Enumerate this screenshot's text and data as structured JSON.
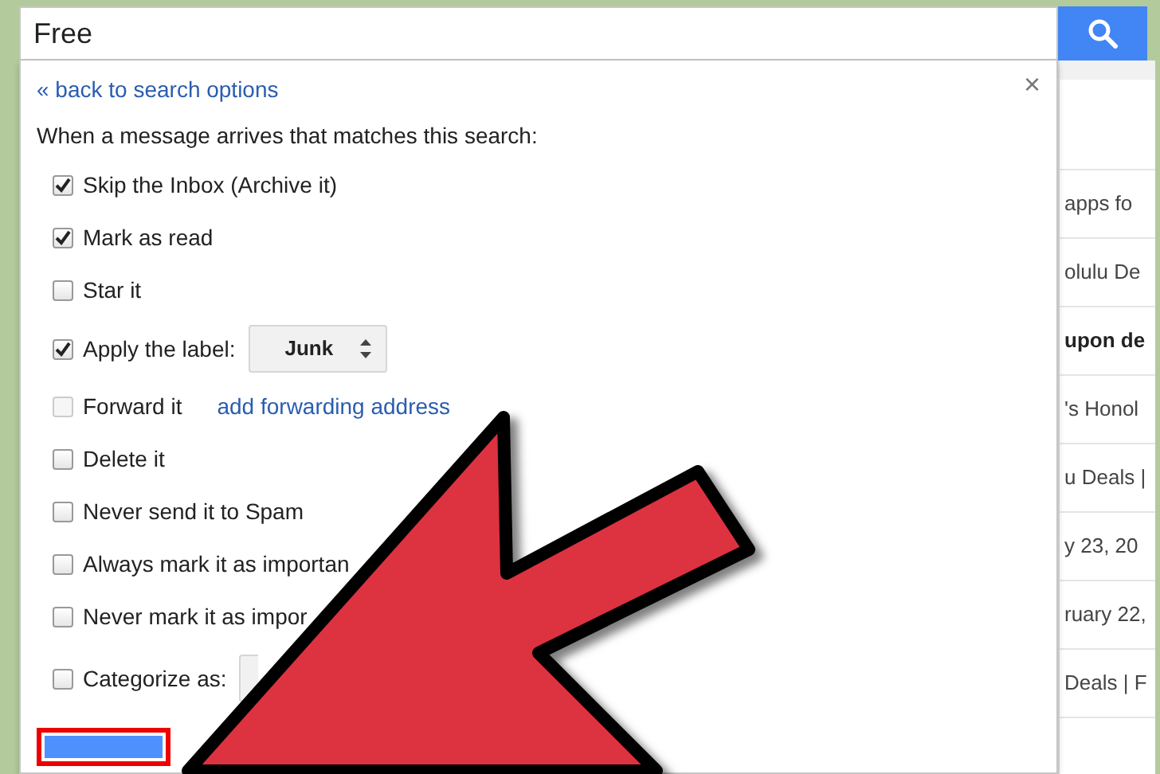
{
  "search": {
    "value": "Free"
  },
  "dialog": {
    "back_link": "« back to search options",
    "close": "×",
    "intro": "When a message arrives that matches this search:",
    "options": [
      {
        "kind": "checkbox",
        "label": "Skip the Inbox (Archive it)",
        "checked": true,
        "disabled": false
      },
      {
        "kind": "checkbox",
        "label": "Mark as read",
        "checked": true,
        "disabled": false
      },
      {
        "kind": "checkbox",
        "label": "Star it",
        "checked": false,
        "disabled": false
      },
      {
        "kind": "select",
        "label": "Apply the label:",
        "checked": true,
        "disabled": false,
        "value": "Junk"
      },
      {
        "kind": "link",
        "label": "Forward it",
        "checked": false,
        "disabled": true,
        "link": "add forwarding address"
      },
      {
        "kind": "checkbox",
        "label": "Delete it",
        "checked": false,
        "disabled": false
      },
      {
        "kind": "checkbox",
        "label": "Never send it to Spam",
        "checked": false,
        "disabled": false
      },
      {
        "kind": "checkbox",
        "label": "Always mark it as importan",
        "checked": false,
        "disabled": false
      },
      {
        "kind": "checkbox",
        "label": "Never mark it as impor",
        "checked": false,
        "disabled": false
      },
      {
        "kind": "select",
        "label": "Categorize as:",
        "checked": false,
        "disabled": false
      }
    ]
  },
  "email_list": [
    {
      "text": "apps fo",
      "unread": false
    },
    {
      "text": "olulu De",
      "unread": false
    },
    {
      "text": "upon de",
      "unread": true
    },
    {
      "text": "'s Honol",
      "unread": false
    },
    {
      "text": "u Deals |",
      "unread": false
    },
    {
      "text": "y 23, 20",
      "unread": false
    },
    {
      "text": "ruary 22,",
      "unread": false
    },
    {
      "text": "Deals | F",
      "unread": false
    }
  ]
}
